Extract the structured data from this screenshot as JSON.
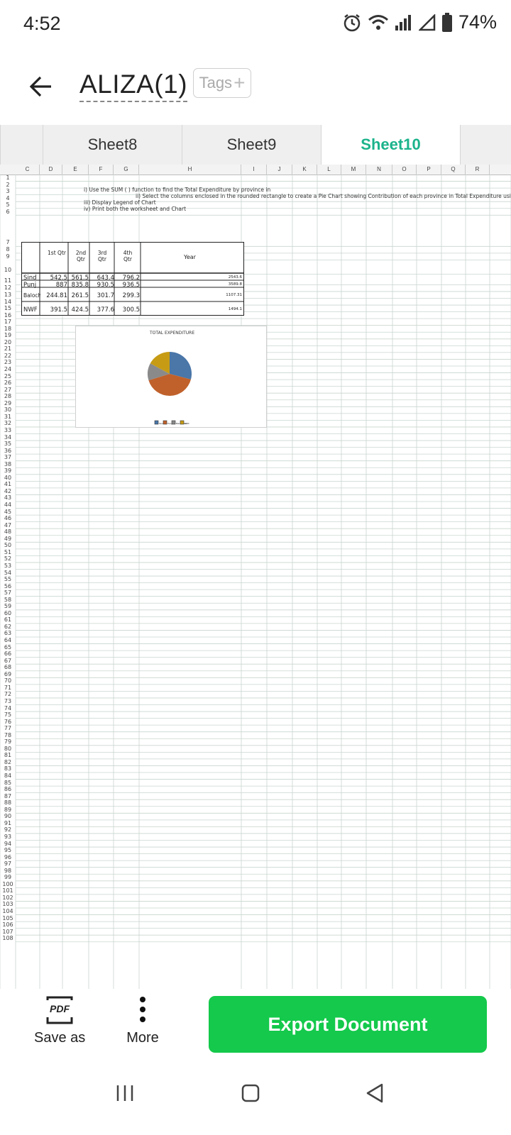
{
  "status": {
    "time": "4:52",
    "battery": "74%"
  },
  "header": {
    "title": "ALIZA(1)",
    "tags_label": "Tags",
    "tags_plus": "+"
  },
  "tabs": [
    {
      "label": "Sheet8",
      "active": false
    },
    {
      "label": "Sheet9",
      "active": false
    },
    {
      "label": "Sheet10",
      "active": true
    }
  ],
  "sheet": {
    "columns": [
      "C",
      "D",
      "E",
      "F",
      "G",
      "H",
      "I",
      "J",
      "K",
      "L",
      "M",
      "N",
      "O",
      "P",
      "Q",
      "R"
    ],
    "instructions": [
      "i) Use the SUM ( ) function to find the Total Expenditure by province in",
      "ii) Select the columns enclosed in the rounded rectangle to create a Pie Chart showing Contribution of each province in Total Expenditure using Chart",
      "iii) Display Legend of Chart",
      "iv) Print both the worksheet and Chart"
    ],
    "table_headers": [
      "1st Qtr",
      "2nd Qtr",
      "3rd Qtr",
      "4th Qtr",
      "Year"
    ],
    "table_rows": [
      {
        "name": "Sind",
        "q1": "542.5",
        "q2": "561.5",
        "q3": "643.4",
        "q4": "796.2",
        "year": "2543.6"
      },
      {
        "name": "Punj",
        "q1": "887",
        "q2": "835.8",
        "q3": "930.5",
        "q4": "936.5",
        "year": "3589.8"
      },
      {
        "name": "Balochistan",
        "q1": "244.81",
        "q2": "261.5",
        "q3": "301.7",
        "q4": "299.3",
        "year": "1107.31"
      },
      {
        "name": "NWF",
        "q1": "391.5",
        "q2": "424.5",
        "q3": "377.6",
        "q4": "300.5",
        "year": "1494.1"
      }
    ]
  },
  "chart_data": {
    "type": "pie",
    "title": "TOTAL EXPENDITURE",
    "categories": [
      "Sind",
      "Punj",
      "Balochistan",
      "NWF"
    ],
    "values": [
      2543.6,
      3589.8,
      1107.31,
      1494.1
    ],
    "colors": [
      "#4a76a8",
      "#c0612b",
      "#8a8a8a",
      "#c79c14"
    ],
    "legend": "bottom"
  },
  "bottom": {
    "save_as": "Save as",
    "pdf_label": "PDF",
    "more": "More",
    "export": "Export Document"
  }
}
